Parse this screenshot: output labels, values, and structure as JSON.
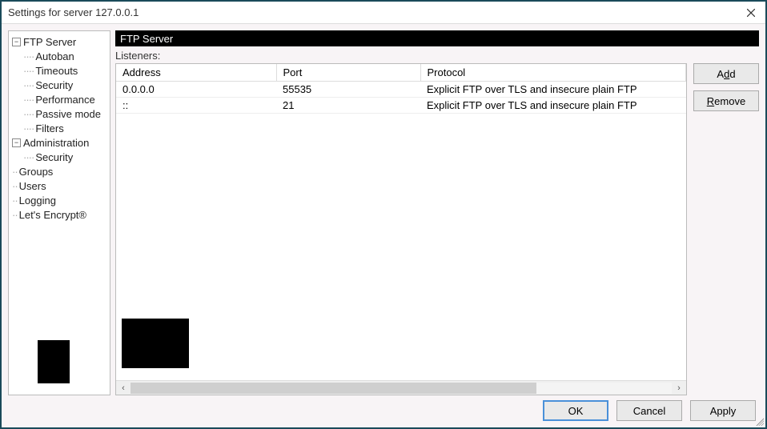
{
  "window": {
    "title": "Settings for server 127.0.0.1"
  },
  "tree": {
    "ftp_server": "FTP Server",
    "ftp_children": {
      "autoban": "Autoban",
      "timeouts": "Timeouts",
      "security": "Security",
      "performance": "Performance",
      "passive_mode": "Passive mode",
      "filters": "Filters"
    },
    "administration": "Administration",
    "admin_children": {
      "security": "Security"
    },
    "groups": "Groups",
    "users": "Users",
    "logging": "Logging",
    "lets_encrypt": "Let's Encrypt®"
  },
  "section": {
    "title": "FTP Server",
    "listeners_label": "Listeners:"
  },
  "table": {
    "headers": {
      "address": "Address",
      "port": "Port",
      "protocol": "Protocol"
    },
    "rows": [
      {
        "address": "0.0.0.0",
        "port": "55535",
        "protocol": "Explicit FTP over TLS and insecure plain FTP"
      },
      {
        "address": "::",
        "port": "21",
        "protocol": "Explicit FTP over TLS and insecure plain FTP"
      }
    ]
  },
  "buttons": {
    "add": "Add",
    "remove": "Remove",
    "ok": "OK",
    "cancel": "Cancel",
    "apply": "Apply"
  }
}
